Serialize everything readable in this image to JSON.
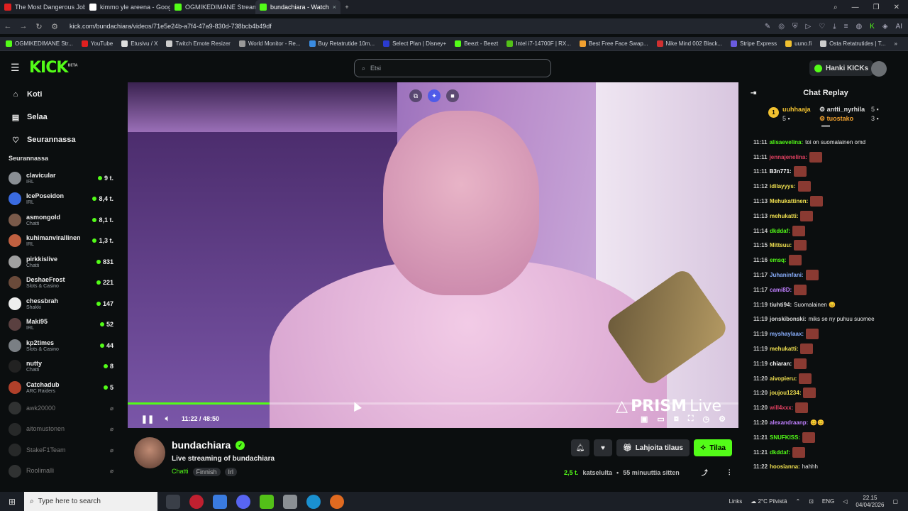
{
  "browser": {
    "tabs": [
      {
        "title": "The Most Dangerous Job",
        "color": "#e02020"
      },
      {
        "title": "kimmo yle areena - Goog",
        "color": "#ffffff"
      },
      {
        "title": "OGMIKEDIMANE Stream",
        "color": "#53fc18"
      },
      {
        "title": "bundachiara - Watch",
        "color": "#53fc18"
      }
    ],
    "url": "kick.com/bundachiara/videos/71e5e24b-a7f4-47a9-830d-738bcb4b49df",
    "bookmarks": [
      {
        "label": "OGMIKEDIMANE Str...",
        "color": "#53fc18"
      },
      {
        "label": "YouTube",
        "color": "#e02020"
      },
      {
        "label": "Etusivu / X",
        "color": "#dddddd"
      },
      {
        "label": "Twitch Emote Resizer",
        "color": "#cccccc"
      },
      {
        "label": "World Monitor - Re...",
        "color": "#999999"
      },
      {
        "label": "Buy Retatrutide 10m...",
        "color": "#3a8be0"
      },
      {
        "label": "Select Plan | Disney+",
        "color": "#2a3bd0"
      },
      {
        "label": "Beezt - Beezt",
        "color": "#53fc18"
      },
      {
        "label": "Intel i7-14700F | RX...",
        "color": "#53c018"
      },
      {
        "label": "Best Free Face Swap...",
        "color": "#f0a030"
      },
      {
        "label": "Nike Mind 002 Black...",
        "color": "#d03030"
      },
      {
        "label": "Stripe Express",
        "color": "#6a5be0"
      },
      {
        "label": "uuno.fi",
        "color": "#f0c030"
      },
      {
        "label": "Osta Retatrutides | T...",
        "color": "#cccccc"
      }
    ]
  },
  "header": {
    "logo": "KICK",
    "logo_beta": "BETA",
    "search_placeholder": "Etsi",
    "kicks_label": "Hanki KICKs"
  },
  "sidebar": {
    "nav": [
      {
        "label": "Koti",
        "icon": "home-icon"
      },
      {
        "label": "Selaa",
        "icon": "browse-icon"
      },
      {
        "label": "Seurannassa",
        "icon": "heart-icon"
      }
    ],
    "following_heading": "Seurannassa",
    "following": [
      {
        "name": "clavicular",
        "category": "IRL",
        "viewers": "9 t.",
        "live": true,
        "color": "#8a8f94"
      },
      {
        "name": "IcePoseidon",
        "category": "IRL",
        "viewers": "8,4 t.",
        "live": true,
        "color": "#3a6be0"
      },
      {
        "name": "asmongold",
        "category": "Chatti",
        "viewers": "8,1 t.",
        "live": true,
        "color": "#7a5a4a"
      },
      {
        "name": "kuhimanvirallinen",
        "category": "IRL",
        "viewers": "1,3 t.",
        "live": true,
        "color": "#c06040"
      },
      {
        "name": "pirkkislive",
        "category": "Chatti",
        "viewers": "831",
        "live": true,
        "color": "#a0a0a0"
      },
      {
        "name": "DeshaeFrost",
        "category": "Slots & Casino",
        "viewers": "221",
        "live": true,
        "color": "#6a4a3a"
      },
      {
        "name": "chessbrah",
        "category": "Shakki",
        "viewers": "147",
        "live": true,
        "color": "#eeeeee"
      },
      {
        "name": "Maki95",
        "category": "IRL",
        "viewers": "52",
        "live": true,
        "color": "#5a4040"
      },
      {
        "name": "kp2times",
        "category": "Slots & Casino",
        "viewers": "44",
        "live": true,
        "color": "#7a7f84"
      },
      {
        "name": "nutty",
        "category": "Chatti",
        "viewers": "8",
        "live": true,
        "color": "#222222"
      },
      {
        "name": "Catchadub",
        "category": "ARC Raiders",
        "viewers": "5",
        "live": true,
        "color": "#b0402a"
      },
      {
        "name": "awk20000",
        "category": "",
        "viewers": "",
        "live": false,
        "color": "#555555"
      },
      {
        "name": "aitomustonen",
        "category": "",
        "viewers": "",
        "live": false,
        "color": "#444444"
      },
      {
        "name": "StakeF1Team",
        "category": "",
        "viewers": "",
        "live": false,
        "color": "#444444"
      },
      {
        "name": "Roolimalli",
        "category": "",
        "viewers": "",
        "live": false,
        "color": "#555555"
      }
    ]
  },
  "player": {
    "elapsed": "11:22",
    "duration": "48:50",
    "progress": 0.2328,
    "overlay_brand": "PRISM",
    "overlay_brand2": "Live"
  },
  "channel": {
    "name": "bundachiara",
    "title": "Live streaming of bundachiara",
    "category": "Chatti",
    "tags": [
      "Finnish",
      "Irl"
    ],
    "gift_label": "Lahjoita tilaus",
    "subscribe_label": "Tilaa",
    "views": "2,5 t.",
    "views_label": "katselulta",
    "ago": "55 minuuttia sitten"
  },
  "chat": {
    "title": "Chat Replay",
    "gifters": {
      "rank": "1",
      "top_name": "uuhhaaja",
      "top_count": "5",
      "second_name": "antti_nyrhila",
      "second_count": "5",
      "third_name": "tuostako",
      "third_count": "3"
    },
    "messages": [
      {
        "time": "11:11",
        "user": "alisaevelina:",
        "color": "#53fc18",
        "text": "toi on suomalainen omd",
        "emote": false
      },
      {
        "time": "11:11",
        "user": "jennajenelina:",
        "color": "#e04060",
        "text": "",
        "emote": true
      },
      {
        "time": "11:11",
        "user": "B3n771:",
        "color": "#ffffff",
        "text": "",
        "emote": true
      },
      {
        "time": "11:12",
        "user": "idilayyys:",
        "color": "#f0e050",
        "text": "",
        "emote": true
      },
      {
        "time": "11:13",
        "user": "Mehukattinen:",
        "color": "#f0e050",
        "text": "",
        "emote": true
      },
      {
        "time": "11:13",
        "user": "mehukatti:",
        "color": "#f0e050",
        "text": "",
        "emote": true
      },
      {
        "time": "11:14",
        "user": "dkddaf:",
        "color": "#53fc18",
        "text": "",
        "emote": true
      },
      {
        "time": "11:15",
        "user": "Mittsuu:",
        "color": "#f0e050",
        "text": "",
        "emote": true
      },
      {
        "time": "11:16",
        "user": "emsq:",
        "color": "#53fc18",
        "text": "",
        "emote": true
      },
      {
        "time": "11:17",
        "user": "Juhaninfani:",
        "color": "#8ab0ff",
        "text": "",
        "emote": true
      },
      {
        "time": "11:17",
        "user": "cami8D:",
        "color": "#c080ff",
        "text": "",
        "emote": true
      },
      {
        "time": "11:19",
        "user": "tiuhti94:",
        "color": "#dddddd",
        "text": "Suomalainen 😊",
        "emote": false
      },
      {
        "time": "11:19",
        "user": "jonskibonski:",
        "color": "#dddddd",
        "text": "miks se ny puhuu suomee",
        "emote": false
      },
      {
        "time": "11:19",
        "user": "myshaylaax:",
        "color": "#8ab0ff",
        "text": "",
        "emote": true
      },
      {
        "time": "11:19",
        "user": "mehukatti:",
        "color": "#f0e050",
        "text": "",
        "emote": true
      },
      {
        "time": "11:19",
        "user": "chiaran:",
        "color": "#ffffff",
        "text": "",
        "emote": true
      },
      {
        "time": "11:20",
        "user": "aivopieru:",
        "color": "#f0e050",
        "text": "",
        "emote": true
      },
      {
        "time": "11:20",
        "user": "joujou1234:",
        "color": "#f0e050",
        "text": "",
        "emote": true
      },
      {
        "time": "11:20",
        "user": "will4xxx:",
        "color": "#e04060",
        "text": "",
        "emote": true
      },
      {
        "time": "11:20",
        "user": "alexandraanp:",
        "color": "#c080ff",
        "text": "😊😊",
        "emote": false
      },
      {
        "time": "11:21",
        "user": "SNUFKISS:",
        "color": "#53fc18",
        "text": "",
        "emote": true
      },
      {
        "time": "11:21",
        "user": "dkddaf:",
        "color": "#53fc18",
        "text": "",
        "emote": true
      },
      {
        "time": "11:22",
        "user": "hoosianna:",
        "color": "#f0e050",
        "text": "hahhh",
        "emote": false
      }
    ]
  },
  "taskbar": {
    "search_placeholder": "Type here to search",
    "links": "Links",
    "weather": "2°C Pilvistä",
    "lang": "ENG",
    "time": "22.15",
    "date": "04/04/2026"
  }
}
